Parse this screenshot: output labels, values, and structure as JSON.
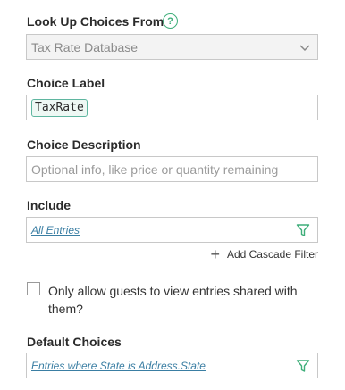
{
  "lookup": {
    "label": "Look Up Choices From",
    "help": "?",
    "value": "Tax Rate Database"
  },
  "choice_label": {
    "label": "Choice Label",
    "token": "TaxRate"
  },
  "choice_description": {
    "label": "Choice Description",
    "placeholder": "Optional info, like price or quantity remaining"
  },
  "include": {
    "label": "Include",
    "filter_text": "All Entries",
    "cascade": "Add Cascade Filter"
  },
  "guests": {
    "label": "Only allow guests to view entries shared with them?"
  },
  "default_choices": {
    "label": "Default Choices",
    "filter_text": "Entries where State is Address.State"
  },
  "colors": {
    "accent": "#3fae7a",
    "link": "#3a7ea3"
  }
}
